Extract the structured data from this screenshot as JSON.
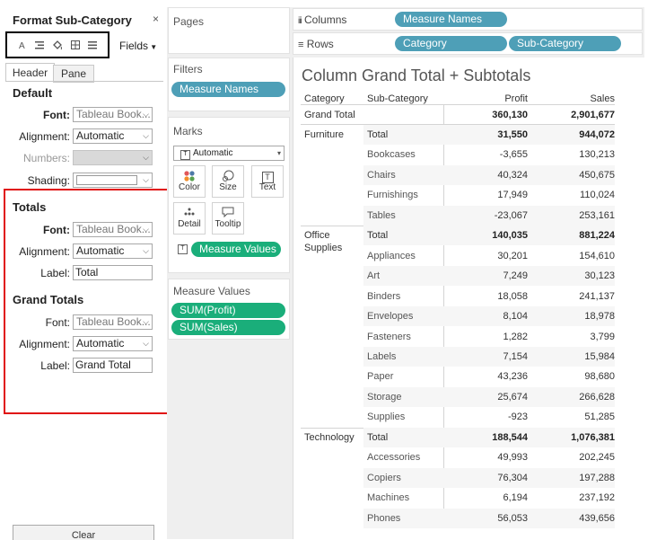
{
  "format_panel": {
    "title": "Format Sub-Category",
    "close": "×",
    "fields_label": "Fields",
    "tabs": [
      "Header",
      "Pane"
    ],
    "default": {
      "heading": "Default",
      "font_label": "Font:",
      "font_value": "Tableau Book...",
      "alignment_label": "Alignment:",
      "alignment_value": "Automatic",
      "numbers_label": "Numbers:",
      "shading_label": "Shading:"
    },
    "totals": {
      "heading": "Totals",
      "font_label": "Font:",
      "font_value": "Tableau Book...",
      "alignment_label": "Alignment:",
      "alignment_value": "Automatic",
      "label_label": "Label:",
      "label_value": "Total"
    },
    "grand_totals": {
      "heading": "Grand Totals",
      "font_label": "Font:",
      "font_value": "Tableau Book...",
      "alignment_label": "Alignment:",
      "alignment_value": "Automatic",
      "label_label": "Label:",
      "label_value": "Grand Total"
    },
    "clear_label": "Clear"
  },
  "pages": {
    "title": "Pages"
  },
  "filters": {
    "title": "Filters",
    "pills": [
      "Measure Names"
    ]
  },
  "marks": {
    "title": "Marks",
    "type": "Automatic",
    "buttons": [
      "Color",
      "Size",
      "Text",
      "Detail",
      "Tooltip"
    ],
    "measure_values_pill": "Measure Values"
  },
  "measure_values": {
    "title": "Measure Values",
    "pills": [
      "SUM(Profit)",
      "SUM(Sales)"
    ]
  },
  "shelves": {
    "columns_label": "Columns",
    "columns_pills": [
      "Measure Names"
    ],
    "rows_label": "Rows",
    "rows_pills": [
      "Category",
      "Sub-Category"
    ]
  },
  "view": {
    "title": "Column Grand Total + Subtotals",
    "headers": [
      "Category",
      "Sub-Category",
      "Profit",
      "Sales"
    ],
    "grand_total": {
      "label": "Grand Total",
      "profit": "360,130",
      "sales": "2,901,677"
    },
    "categories": [
      {
        "name_lines": [
          "Furniture"
        ],
        "rows": [
          {
            "sub": "Total",
            "profit": "31,550",
            "sales": "944,072"
          },
          {
            "sub": "Bookcases",
            "profit": "-3,655",
            "sales": "130,213"
          },
          {
            "sub": "Chairs",
            "profit": "40,324",
            "sales": "450,675"
          },
          {
            "sub": "Furnishings",
            "profit": "17,949",
            "sales": "110,024"
          },
          {
            "sub": "Tables",
            "profit": "-23,067",
            "sales": "253,161"
          }
        ]
      },
      {
        "name_lines": [
          "Office",
          "Supplies"
        ],
        "rows": [
          {
            "sub": "Total",
            "profit": "140,035",
            "sales": "881,224"
          },
          {
            "sub": "Appliances",
            "profit": "30,201",
            "sales": "154,610"
          },
          {
            "sub": "Art",
            "profit": "7,249",
            "sales": "30,123"
          },
          {
            "sub": "Binders",
            "profit": "18,058",
            "sales": "241,137"
          },
          {
            "sub": "Envelopes",
            "profit": "8,104",
            "sales": "18,978"
          },
          {
            "sub": "Fasteners",
            "profit": "1,282",
            "sales": "3,799"
          },
          {
            "sub": "Labels",
            "profit": "7,154",
            "sales": "15,984"
          },
          {
            "sub": "Paper",
            "profit": "43,236",
            "sales": "98,680"
          },
          {
            "sub": "Storage",
            "profit": "25,674",
            "sales": "266,628"
          },
          {
            "sub": "Supplies",
            "profit": "-923",
            "sales": "51,285"
          }
        ]
      },
      {
        "name_lines": [
          "Technology"
        ],
        "rows": [
          {
            "sub": "Total",
            "profit": "188,544",
            "sales": "1,076,381"
          },
          {
            "sub": "Accessories",
            "profit": "49,993",
            "sales": "202,245"
          },
          {
            "sub": "Copiers",
            "profit": "76,304",
            "sales": "197,288"
          },
          {
            "sub": "Machines",
            "profit": "6,194",
            "sales": "237,192"
          },
          {
            "sub": "Phones",
            "profit": "56,053",
            "sales": "439,656"
          }
        ]
      }
    ]
  },
  "colors": {
    "blue_pill": "#4e9fb7",
    "green_pill": "#1aae7a",
    "highlight": "#e01010"
  }
}
